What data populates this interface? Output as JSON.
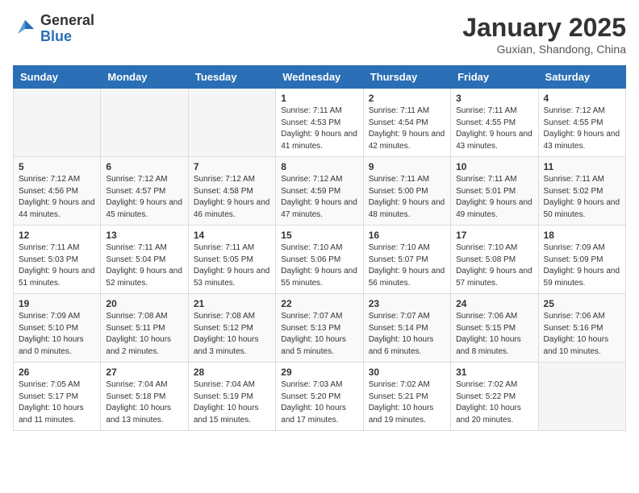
{
  "header": {
    "logo_general": "General",
    "logo_blue": "Blue",
    "month_title": "January 2025",
    "location": "Guxian, Shandong, China"
  },
  "days_of_week": [
    "Sunday",
    "Monday",
    "Tuesday",
    "Wednesday",
    "Thursday",
    "Friday",
    "Saturday"
  ],
  "weeks": [
    [
      {
        "day": "",
        "info": ""
      },
      {
        "day": "",
        "info": ""
      },
      {
        "day": "",
        "info": ""
      },
      {
        "day": "1",
        "info": "Sunrise: 7:11 AM\nSunset: 4:53 PM\nDaylight: 9 hours and 41 minutes."
      },
      {
        "day": "2",
        "info": "Sunrise: 7:11 AM\nSunset: 4:54 PM\nDaylight: 9 hours and 42 minutes."
      },
      {
        "day": "3",
        "info": "Sunrise: 7:11 AM\nSunset: 4:55 PM\nDaylight: 9 hours and 43 minutes."
      },
      {
        "day": "4",
        "info": "Sunrise: 7:12 AM\nSunset: 4:55 PM\nDaylight: 9 hours and 43 minutes."
      }
    ],
    [
      {
        "day": "5",
        "info": "Sunrise: 7:12 AM\nSunset: 4:56 PM\nDaylight: 9 hours and 44 minutes."
      },
      {
        "day": "6",
        "info": "Sunrise: 7:12 AM\nSunset: 4:57 PM\nDaylight: 9 hours and 45 minutes."
      },
      {
        "day": "7",
        "info": "Sunrise: 7:12 AM\nSunset: 4:58 PM\nDaylight: 9 hours and 46 minutes."
      },
      {
        "day": "8",
        "info": "Sunrise: 7:12 AM\nSunset: 4:59 PM\nDaylight: 9 hours and 47 minutes."
      },
      {
        "day": "9",
        "info": "Sunrise: 7:11 AM\nSunset: 5:00 PM\nDaylight: 9 hours and 48 minutes."
      },
      {
        "day": "10",
        "info": "Sunrise: 7:11 AM\nSunset: 5:01 PM\nDaylight: 9 hours and 49 minutes."
      },
      {
        "day": "11",
        "info": "Sunrise: 7:11 AM\nSunset: 5:02 PM\nDaylight: 9 hours and 50 minutes."
      }
    ],
    [
      {
        "day": "12",
        "info": "Sunrise: 7:11 AM\nSunset: 5:03 PM\nDaylight: 9 hours and 51 minutes."
      },
      {
        "day": "13",
        "info": "Sunrise: 7:11 AM\nSunset: 5:04 PM\nDaylight: 9 hours and 52 minutes."
      },
      {
        "day": "14",
        "info": "Sunrise: 7:11 AM\nSunset: 5:05 PM\nDaylight: 9 hours and 53 minutes."
      },
      {
        "day": "15",
        "info": "Sunrise: 7:10 AM\nSunset: 5:06 PM\nDaylight: 9 hours and 55 minutes."
      },
      {
        "day": "16",
        "info": "Sunrise: 7:10 AM\nSunset: 5:07 PM\nDaylight: 9 hours and 56 minutes."
      },
      {
        "day": "17",
        "info": "Sunrise: 7:10 AM\nSunset: 5:08 PM\nDaylight: 9 hours and 57 minutes."
      },
      {
        "day": "18",
        "info": "Sunrise: 7:09 AM\nSunset: 5:09 PM\nDaylight: 9 hours and 59 minutes."
      }
    ],
    [
      {
        "day": "19",
        "info": "Sunrise: 7:09 AM\nSunset: 5:10 PM\nDaylight: 10 hours and 0 minutes."
      },
      {
        "day": "20",
        "info": "Sunrise: 7:08 AM\nSunset: 5:11 PM\nDaylight: 10 hours and 2 minutes."
      },
      {
        "day": "21",
        "info": "Sunrise: 7:08 AM\nSunset: 5:12 PM\nDaylight: 10 hours and 3 minutes."
      },
      {
        "day": "22",
        "info": "Sunrise: 7:07 AM\nSunset: 5:13 PM\nDaylight: 10 hours and 5 minutes."
      },
      {
        "day": "23",
        "info": "Sunrise: 7:07 AM\nSunset: 5:14 PM\nDaylight: 10 hours and 6 minutes."
      },
      {
        "day": "24",
        "info": "Sunrise: 7:06 AM\nSunset: 5:15 PM\nDaylight: 10 hours and 8 minutes."
      },
      {
        "day": "25",
        "info": "Sunrise: 7:06 AM\nSunset: 5:16 PM\nDaylight: 10 hours and 10 minutes."
      }
    ],
    [
      {
        "day": "26",
        "info": "Sunrise: 7:05 AM\nSunset: 5:17 PM\nDaylight: 10 hours and 11 minutes."
      },
      {
        "day": "27",
        "info": "Sunrise: 7:04 AM\nSunset: 5:18 PM\nDaylight: 10 hours and 13 minutes."
      },
      {
        "day": "28",
        "info": "Sunrise: 7:04 AM\nSunset: 5:19 PM\nDaylight: 10 hours and 15 minutes."
      },
      {
        "day": "29",
        "info": "Sunrise: 7:03 AM\nSunset: 5:20 PM\nDaylight: 10 hours and 17 minutes."
      },
      {
        "day": "30",
        "info": "Sunrise: 7:02 AM\nSunset: 5:21 PM\nDaylight: 10 hours and 19 minutes."
      },
      {
        "day": "31",
        "info": "Sunrise: 7:02 AM\nSunset: 5:22 PM\nDaylight: 10 hours and 20 minutes."
      },
      {
        "day": "",
        "info": ""
      }
    ]
  ]
}
